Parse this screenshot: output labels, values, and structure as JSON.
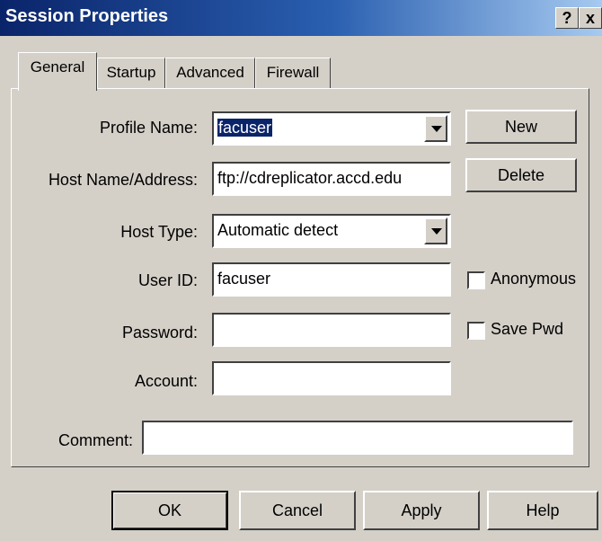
{
  "window": {
    "title": "Session Properties",
    "help_icon": "?",
    "close_icon": "x"
  },
  "tabs": [
    {
      "label": "General",
      "active": true
    },
    {
      "label": "Startup",
      "active": false
    },
    {
      "label": "Advanced",
      "active": false
    },
    {
      "label": "Firewall",
      "active": false
    }
  ],
  "form": {
    "profile_name": {
      "label": "Profile Name:",
      "value": "facuser"
    },
    "host_name": {
      "label": "Host Name/Address:",
      "value": "ftp://cdreplicator.accd.edu"
    },
    "host_type": {
      "label": "Host Type:",
      "value": "Automatic detect"
    },
    "user_id": {
      "label": "User ID:",
      "value": "facuser"
    },
    "password": {
      "label": "Password:",
      "value": ""
    },
    "account": {
      "label": "Account:",
      "value": ""
    },
    "comment": {
      "label": "Comment:",
      "value": ""
    }
  },
  "side_buttons": {
    "new": "New",
    "delete": "Delete"
  },
  "checkboxes": {
    "anonymous": {
      "label": "Anonymous",
      "checked": false
    },
    "save_pwd": {
      "label": "Save Pwd",
      "checked": false
    }
  },
  "footer": {
    "ok": "OK",
    "cancel": "Cancel",
    "apply": "Apply",
    "help": "Help"
  }
}
